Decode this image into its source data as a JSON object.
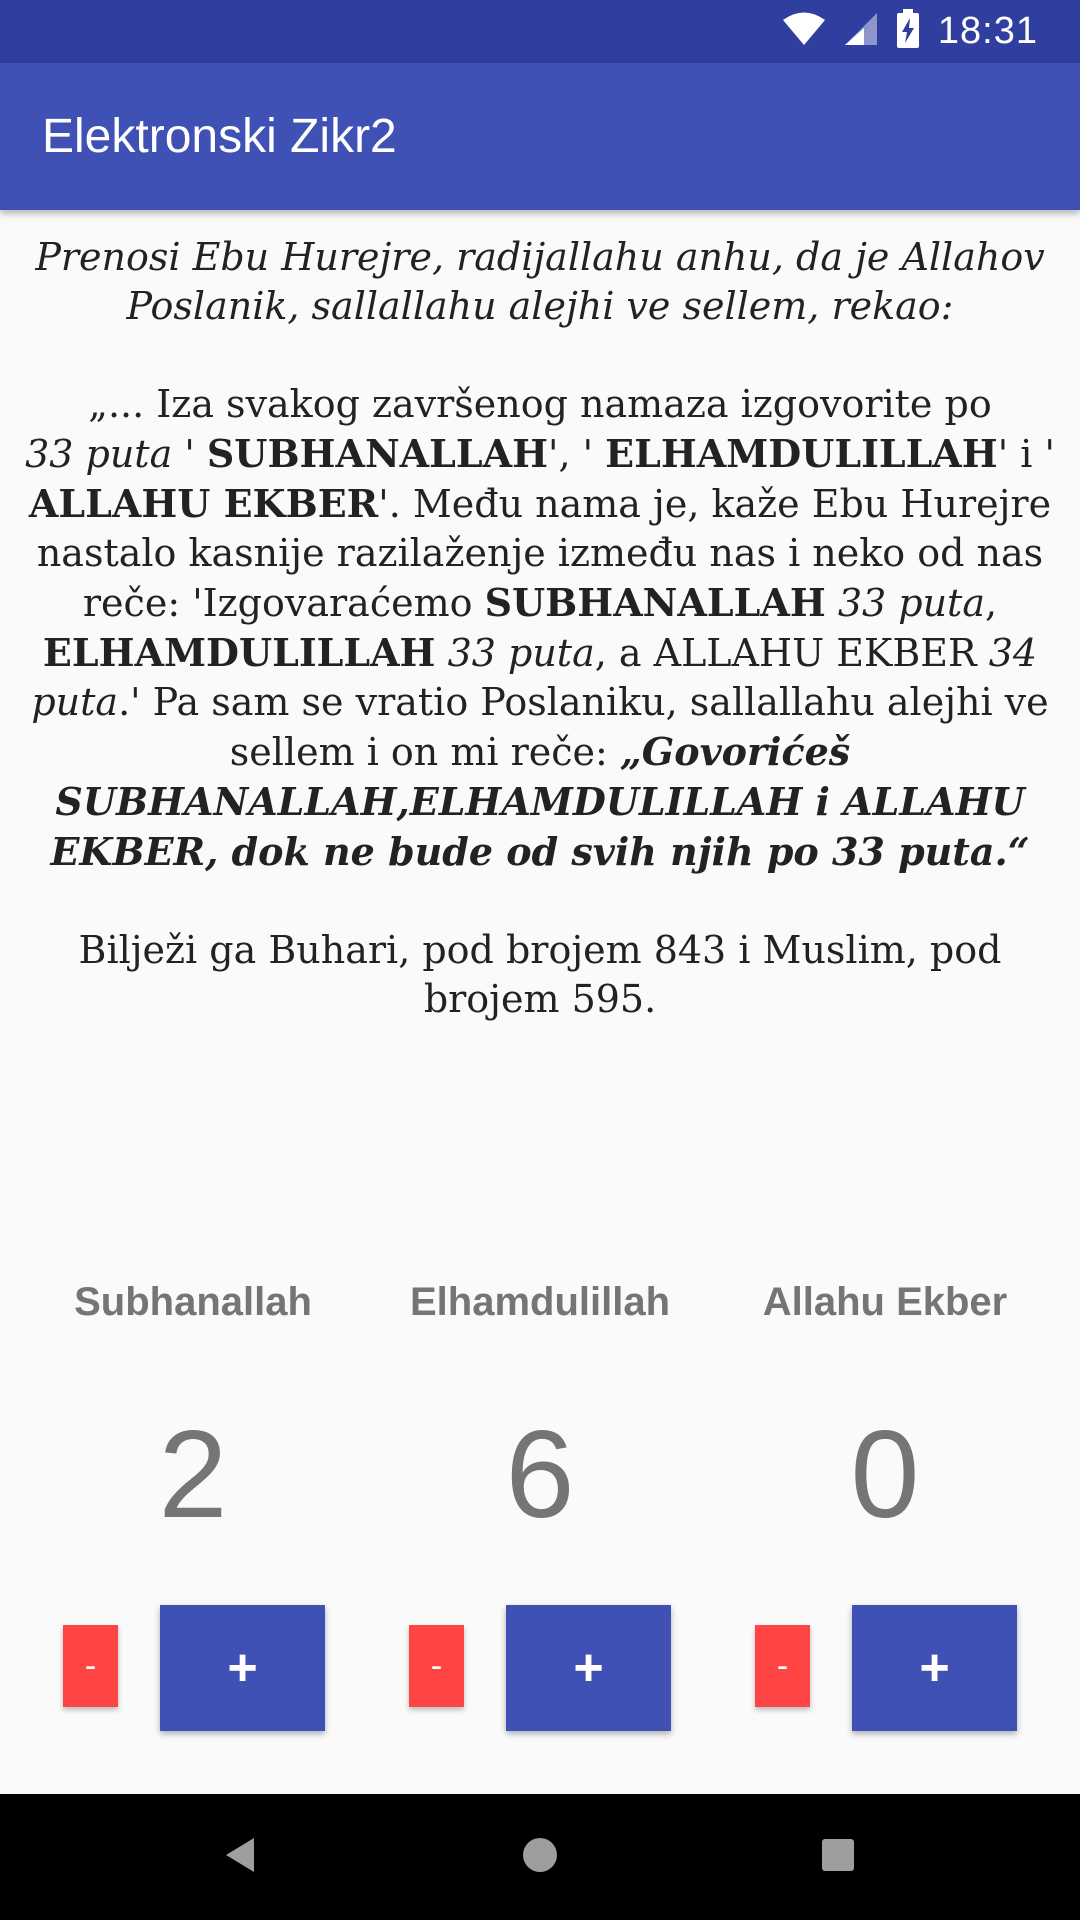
{
  "status_bar": {
    "time": "18:31",
    "icons": [
      "wifi-icon",
      "signal-icon",
      "battery-charging-icon"
    ]
  },
  "app_bar": {
    "title": "Elektronski Zikr2"
  },
  "hadith": {
    "intro": "Prenosi Ebu Hurejre, radijallahu anhu, da je Allahov Poslanik, sallallahu alejhi ve sellem, rekao:",
    "p1_a": "„... Iza svakog završenog namaza izgovorite po",
    "p1_b": "33 puta",
    "p1_c": " ' ",
    "p1_d": "SUBHANALLAH",
    "p1_e": "', ' ",
    "p1_f": "ELHAMDULILLAH",
    "p1_g": "' i ' ",
    "p1_h": "ALLAHU EKBER",
    "p1_i": "'. Među nama je, kaže Ebu Hurejre nastalo kasnije razilaženje između nas i neko od nas reče: 'Izgovaraćemo ",
    "p1_j": "SUBHANALLAH",
    "p1_k": "33 puta",
    "p1_l": ", ",
    "p1_m": "ELHAMDULILLAH",
    "p1_n": "33 puta",
    "p1_o": ", a ALLAHU EKBER ",
    "p1_p": "34 puta",
    "p1_q": ".' Pa sam se vratio Poslaniku, sallallahu alejhi ve sellem i on mi reče: ",
    "p1_r": "„Govorićeš SUBHANALLAH,ELHAMDULILLAH i ALLAHU EKBER, dok ne bude od svih njih po 33 puta.“",
    "source": "Bilježi ga Buhari, pod brojem 843 i Muslim, pod brojem 595."
  },
  "counters": [
    {
      "label": "Subhanallah",
      "value": "2",
      "minus_label": "-",
      "plus_label": "+"
    },
    {
      "label": "Elhamdulillah",
      "value": "6",
      "minus_label": "-",
      "plus_label": "+"
    },
    {
      "label": "Allahu Ekber",
      "value": "0",
      "minus_label": "-",
      "plus_label": "+"
    }
  ],
  "nav_bar": {
    "icons": [
      "back-icon",
      "home-icon",
      "recents-icon"
    ]
  },
  "colors": {
    "status_bar": "#303f9f",
    "app_bar": "#3f51b5",
    "plus_button": "#3f51b5",
    "minus_button": "#ff4444",
    "counter_text": "#757575"
  }
}
